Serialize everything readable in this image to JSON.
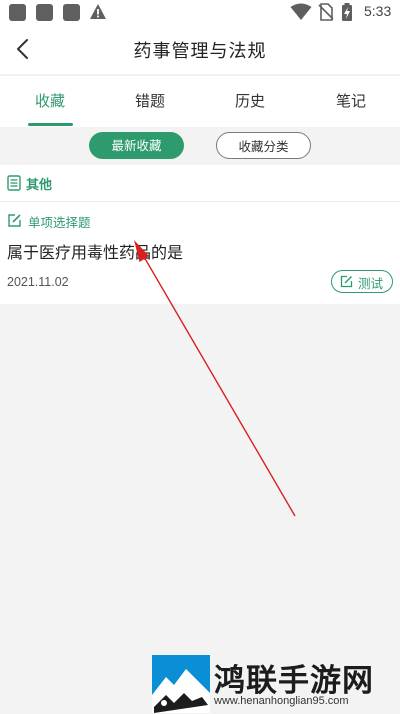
{
  "status_bar": {
    "time": "5:33",
    "icons": [
      "app-icon",
      "app-icon",
      "app-icon",
      "warning-icon",
      "wifi-icon",
      "no-sim-icon",
      "battery-charging-icon"
    ]
  },
  "header": {
    "title": "药事管理与法规",
    "back_icon": "chevron-left-icon"
  },
  "tabs": [
    {
      "label": "收藏",
      "active": true
    },
    {
      "label": "错题",
      "active": false
    },
    {
      "label": "历史",
      "active": false
    },
    {
      "label": "笔记",
      "active": false
    }
  ],
  "filters": {
    "latest": "最新收藏",
    "category": "收藏分类",
    "selected": "latest"
  },
  "category": {
    "label": "其他",
    "icon": "document-list-icon"
  },
  "question": {
    "type_label": "单项选择题",
    "type_icon": "edit-icon",
    "text": "属于医疗用毒性药品的是",
    "date": "2021.11.02",
    "test_label": "测试",
    "test_icon": "edit-box-icon"
  },
  "watermark": {
    "title": "鸿联手游网",
    "url": "www.henanhonglian95.com"
  },
  "colors": {
    "accent": "#2e9b6e",
    "annotation": "#d92020"
  }
}
